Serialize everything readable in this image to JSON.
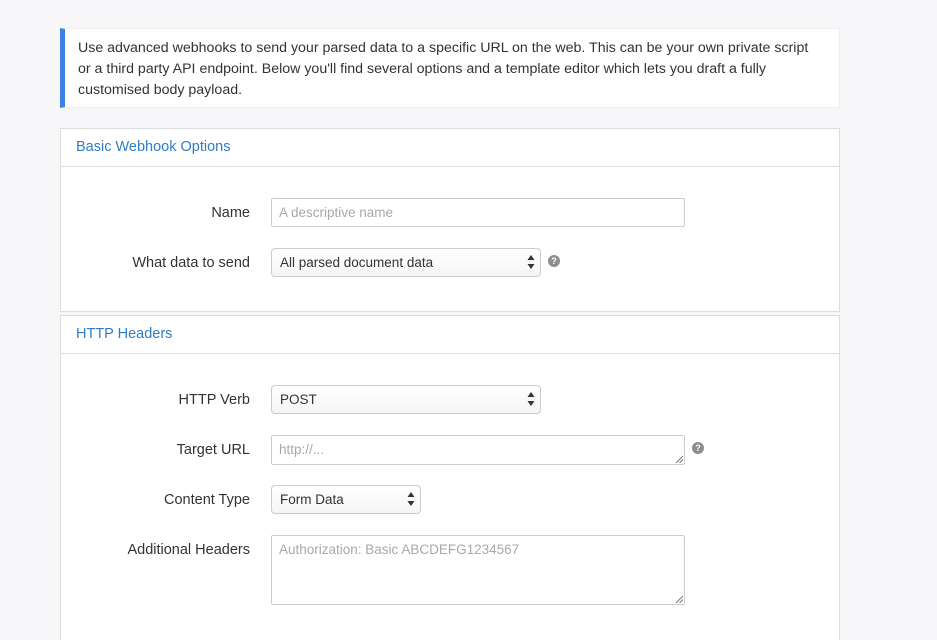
{
  "intro": {
    "line1": "Use advanced webhooks to send your parsed data to a specific URL on the web. This can be your own private script",
    "line2": "or a third party API endpoint. Below you'll find several options and a template editor which lets you draft a fully",
    "line3": "customised body payload."
  },
  "basic": {
    "heading": "Basic Webhook Options",
    "name_label": "Name",
    "name_placeholder": "A descriptive name",
    "data_label": "What data to send",
    "data_value": "All parsed document data"
  },
  "headers": {
    "heading": "HTTP Headers",
    "verb_label": "HTTP Verb",
    "verb_value": "POST",
    "url_label": "Target URL",
    "url_placeholder": "http://...",
    "content_type_label": "Content Type",
    "content_type_value": "Form Data",
    "additional_label": "Additional Headers",
    "additional_placeholder": "Authorization: Basic ABCDEFG1234567"
  },
  "icons": {
    "help": "question-circle-icon",
    "select_arrows": "select-arrows-icon",
    "resize": "resize-grip-icon"
  },
  "colors": {
    "accent": "#3b82e4",
    "heading": "#2f7cc7"
  }
}
